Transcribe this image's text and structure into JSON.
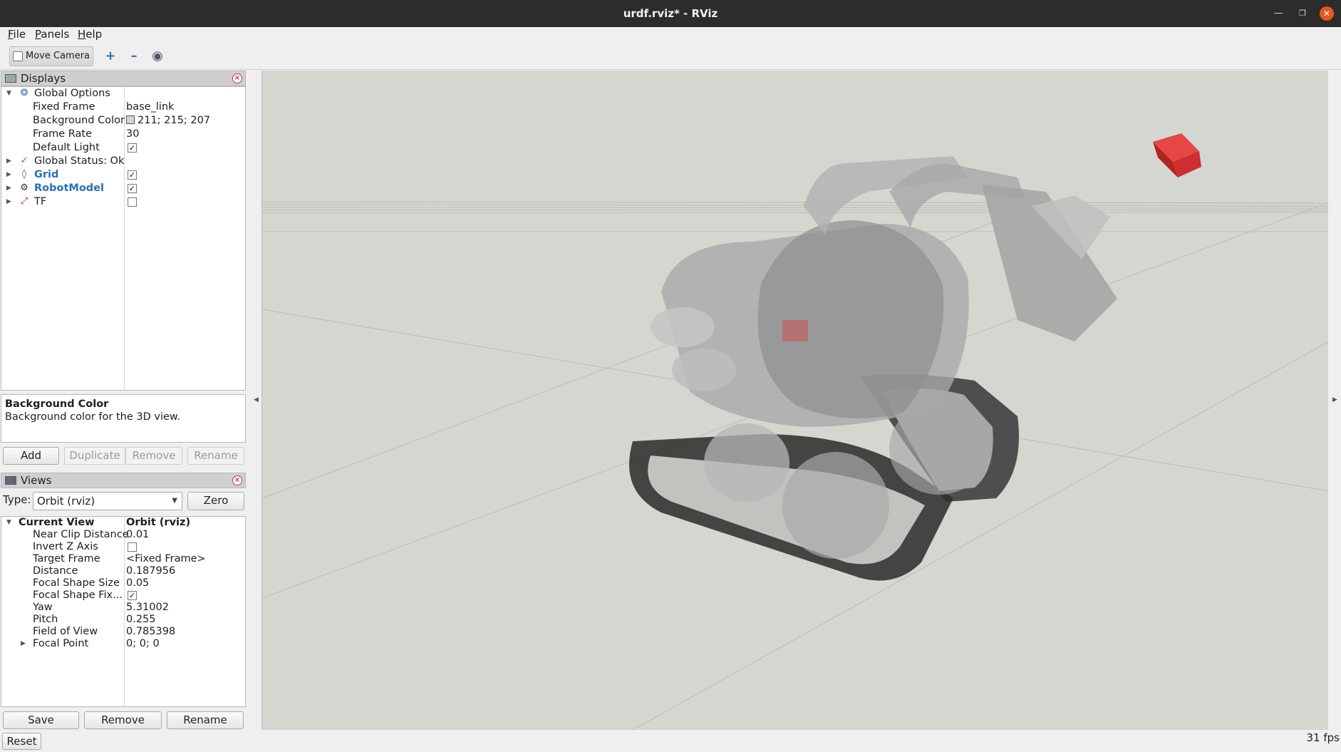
{
  "window": {
    "title": "urdf.rviz* - RViz"
  },
  "menu": {
    "file": "File",
    "panels": "Panels",
    "help": "Help"
  },
  "toolbar": {
    "move_camera": "Move Camera"
  },
  "displays": {
    "header": "Displays",
    "global_options": "Global Options",
    "fixed_frame_label": "Fixed Frame",
    "fixed_frame_value": "base_link",
    "background_color_label": "Background Color",
    "background_color_value": "211; 215; 207",
    "frame_rate_label": "Frame Rate",
    "frame_rate_value": "30",
    "default_light_label": "Default Light",
    "default_light_checked": true,
    "global_status": "Global Status: Ok",
    "grid": "Grid",
    "grid_checked": true,
    "robot_model": "RobotModel",
    "robot_model_checked": true,
    "tf": "TF",
    "tf_checked": false,
    "description_title": "Background Color",
    "description_text": "Background color for the 3D view.",
    "add": "Add",
    "duplicate": "Duplicate",
    "remove": "Remove",
    "rename": "Rename"
  },
  "views": {
    "header": "Views",
    "type_label": "Type:",
    "type_value": "Orbit (rviz)",
    "zero": "Zero",
    "current_view_label": "Current View",
    "current_view_value": "Orbit (rviz)",
    "near_clip_label": "Near Clip Distance",
    "near_clip_value": "0.01",
    "invert_z_label": "Invert Z Axis",
    "invert_z_checked": false,
    "target_frame_label": "Target Frame",
    "target_frame_value": "<Fixed Frame>",
    "distance_label": "Distance",
    "distance_value": "0.187956",
    "focal_size_label": "Focal Shape Size",
    "focal_size_value": "0.05",
    "focal_fixed_label": "Focal Shape Fix...",
    "focal_fixed_checked": true,
    "yaw_label": "Yaw",
    "yaw_value": "5.31002",
    "pitch_label": "Pitch",
    "pitch_value": "0.255",
    "fov_label": "Field of View",
    "fov_value": "0.785398",
    "focal_point_label": "Focal Point",
    "focal_point_value": "0; 0; 0",
    "save": "Save",
    "remove": "Remove",
    "rename": "Rename"
  },
  "status": {
    "reset": "Reset",
    "fps": "31 fps"
  },
  "colors": {
    "viewport_bg": "#d3d7cf",
    "accent_link": "#2a6fb4",
    "titlebar": "#2c2c2c",
    "close": "#e95420",
    "cube": "#d32f2f"
  },
  "icons": [
    "globe-icon",
    "checkmark-icon",
    "grid-icon",
    "robot-icon",
    "axes-icon",
    "monitor-icon",
    "camera-icon",
    "plus-icon",
    "minus-icon",
    "eye-icon"
  ]
}
